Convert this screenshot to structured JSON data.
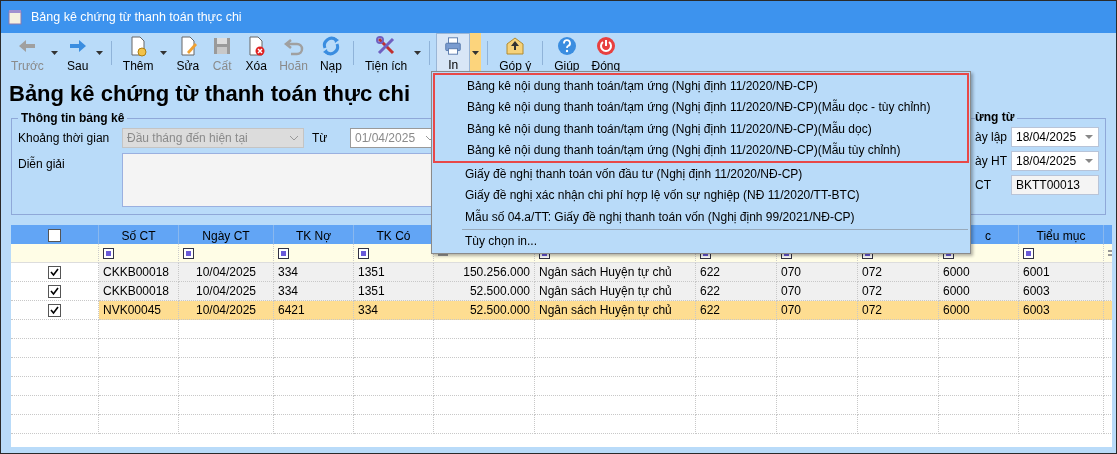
{
  "window": {
    "title": "Bảng kê chứng từ thanh toán thực chi"
  },
  "toolbar": [
    [
      {
        "label": "Trước",
        "disabled": true,
        "has_menu": true,
        "pressed": false
      },
      {
        "label": "Sau",
        "disabled": false,
        "has_menu": true,
        "pressed": false
      }
    ],
    [
      {
        "label": "Thêm",
        "disabled": false,
        "has_menu": true,
        "pressed": false
      },
      {
        "label": "Sửa",
        "disabled": false,
        "has_menu": false,
        "pressed": false
      },
      {
        "label": "Cất",
        "disabled": true,
        "has_menu": false,
        "pressed": false
      },
      {
        "label": "Xóa",
        "disabled": false,
        "has_menu": false,
        "pressed": false
      },
      {
        "label": "Hoãn",
        "disabled": true,
        "has_menu": false,
        "pressed": false
      },
      {
        "label": "Nạp",
        "disabled": false,
        "has_menu": false,
        "pressed": false
      }
    ],
    [
      {
        "label": "Tiện ích",
        "disabled": false,
        "has_menu": true,
        "pressed": false
      }
    ],
    [
      {
        "label": "In",
        "disabled": false,
        "has_menu": true,
        "pressed": true
      }
    ],
    [
      {
        "label": "Góp ý",
        "disabled": false,
        "has_menu": false,
        "pressed": false
      }
    ],
    [
      {
        "label": "Giúp",
        "disabled": false,
        "has_menu": false,
        "pressed": false
      },
      {
        "label": "Đóng",
        "disabled": false,
        "has_menu": false,
        "pressed": false
      }
    ]
  ],
  "page_title": "Bảng kê chứng từ thanh toán thực chi",
  "info_group": {
    "title": "Thông tin bảng kê",
    "period_label": "Khoảng thời gian",
    "period_value": "Đầu tháng đến hiện tại",
    "from_label": "Từ",
    "from_value": "01/04/2025",
    "description_label": "Diễn giải"
  },
  "voucher_group": {
    "title": "ừng từ",
    "fields": [
      {
        "label": "ày lập",
        "value": "18/04/2025",
        "kind": "date"
      },
      {
        "label": "ày HT",
        "value": "18/04/2025",
        "kind": "date"
      },
      {
        "label": "CT",
        "value": "BKTT00013",
        "kind": "text"
      }
    ]
  },
  "table": {
    "select_all_checked": false,
    "columns": [
      {
        "header": "Số CT",
        "kind": "text"
      },
      {
        "header": "Ngày CT",
        "kind": "date"
      },
      {
        "header": "TK Nợ",
        "kind": "text"
      },
      {
        "header": "TK Có",
        "kind": "text"
      },
      {
        "kind": "amount"
      },
      {
        "kind": "text"
      },
      {
        "kind": "text"
      },
      {
        "kind": "text"
      },
      {
        "kind": "text"
      },
      {
        "header": "c",
        "kind": "partial"
      },
      {
        "header": "Tiểu mục",
        "kind": "text"
      }
    ],
    "rows": [
      {
        "checked": true,
        "selected": false,
        "cells": [
          "CKKB00018",
          "10/04/2025",
          "334",
          "1351",
          "150.256.000",
          "Ngân sách Huyện tự chủ",
          "622",
          "070",
          "072",
          "6000",
          "6001"
        ]
      },
      {
        "checked": true,
        "selected": false,
        "cells": [
          "CKKB00018",
          "10/04/2025",
          "334",
          "1351",
          "52.500.000",
          "Ngân sách Huyện tự chủ",
          "622",
          "070",
          "072",
          "6000",
          "6003"
        ]
      },
      {
        "checked": true,
        "selected": true,
        "cells": [
          "NVK00045",
          "10/04/2025",
          "6421",
          "334",
          "52.500.000",
          "Ngân sách Huyện tự chủ",
          "622",
          "070",
          "072",
          "6000",
          "6003"
        ]
      }
    ]
  },
  "print_menu": {
    "items": [
      {
        "label": "Bảng kê nội dung thanh toán/tạm ứng (Nghị định 11/2020/NĐ-CP)",
        "highlighted": true
      },
      {
        "label": "Bảng kê nội dung thanh toán/tạm ứng (Nghị định 11/2020/NĐ-CP)(Mẫu dọc - tùy chỉnh)",
        "highlighted": true
      },
      {
        "label": "Bảng kê nội dung thanh toán/tạm ứng (Nghị định 11/2020/NĐ-CP)(Mẫu dọc)",
        "highlighted": true
      },
      {
        "label": "Bảng kê nội dung thanh toán/tạm ứng (Nghị định 11/2020/NĐ-CP)(Mẫu tùy chỉnh)",
        "highlighted": true
      },
      {
        "label": "Giấy đề nghị thanh toán vốn đầu tư (Nghị định 11/2020/NĐ-CP)",
        "highlighted": false
      },
      {
        "label": "Giấy đề nghị xác nhận chi phí hợp lệ vốn sự nghiệp (NĐ 11/2020/TT-BTC)",
        "highlighted": false
      },
      {
        "label": "Mẫu số 04.a/TT: Giấy đề nghị thanh toán vốn (Nghị định 99/2021/NĐ-CP)",
        "highlighted": false
      }
    ],
    "options_item": "Tùy chọn in..."
  }
}
